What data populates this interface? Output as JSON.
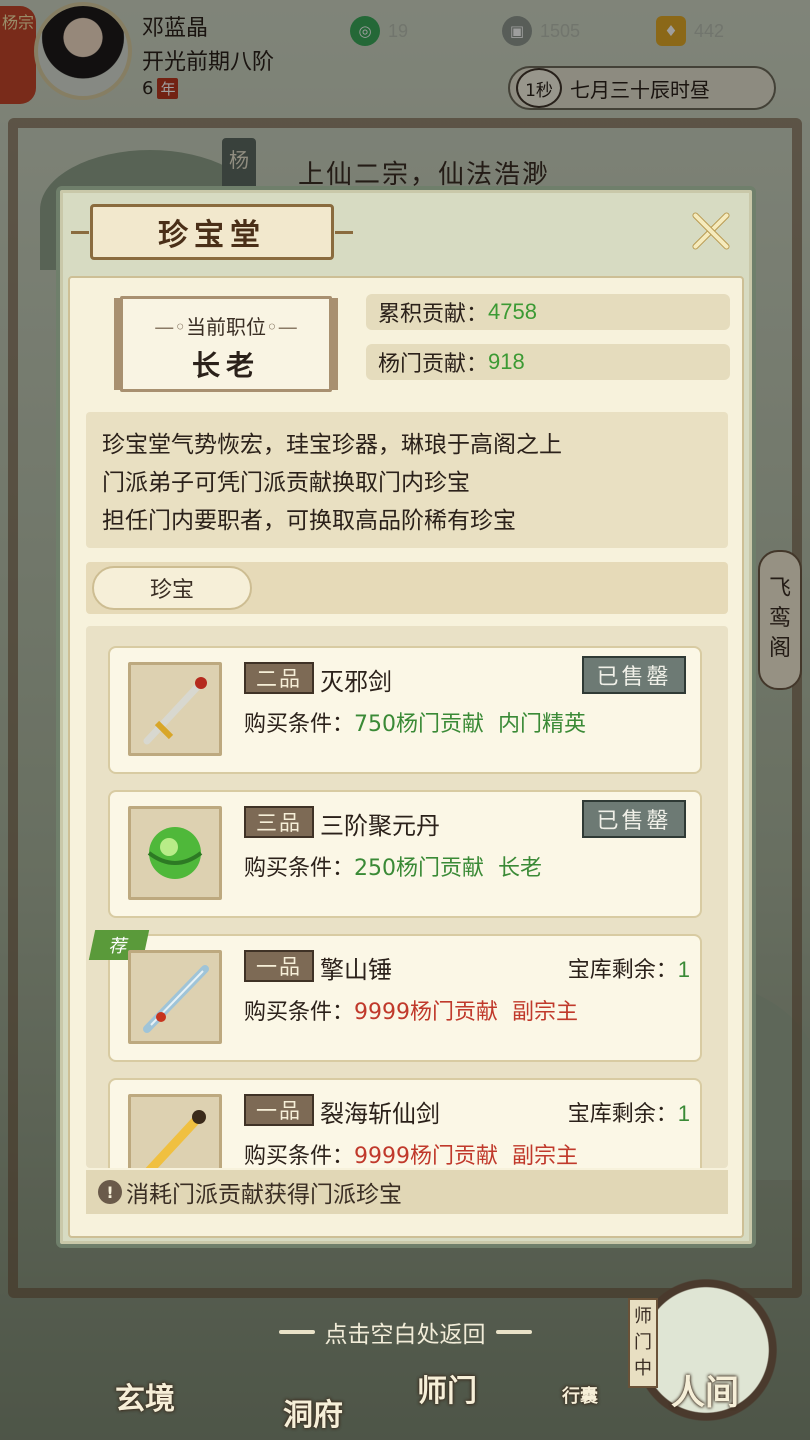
{
  "player": {
    "sect_short": "杨宗",
    "name": "邓蓝晶",
    "realm": "开光前期八阶",
    "age": "6",
    "age_unit": "年"
  },
  "resources": [
    {
      "icon": "jade-icon",
      "value": "19",
      "color": "#3aa85a"
    },
    {
      "icon": "coin-icon",
      "value": "1505",
      "color": "#9aa39a"
    },
    {
      "icon": "gold-ingot-icon",
      "value": "442",
      "color": "#e0a928"
    }
  ],
  "time": {
    "speed": "1秒",
    "date": "七月三十辰时昼"
  },
  "background": {
    "banner": "上仙二宗，仙法浩渺",
    "left_tag": "杨",
    "side_tag": "飞鸾阁"
  },
  "modal": {
    "title": "珍宝堂",
    "position_label": "当前职位",
    "position_value": "长老",
    "total_contrib_label": "累积贡献：",
    "total_contrib_value": "4758",
    "sect_contrib_label": "杨门贡献：",
    "sect_contrib_value": "918",
    "description": [
      "珍宝堂气势恢宏，珪宝珍器，琳琅于高阁之上",
      "门派弟子可凭门派贡献换取门内珍宝",
      "担任门内要职者，可换取高品阶稀有珍宝"
    ],
    "section_tab": "珍宝",
    "cond_label": "购买条件：",
    "items": [
      {
        "grade": "二品",
        "name": "灭邪剑",
        "cost": "750杨门贡献",
        "rank": "内门精英",
        "status": "已售罄",
        "stock_label": "",
        "stock": "",
        "recommended": false,
        "color": "#3a8a36"
      },
      {
        "grade": "三品",
        "name": "三阶聚元丹",
        "cost": "250杨门贡献",
        "rank": "长老",
        "status": "已售罄",
        "stock_label": "",
        "stock": "",
        "recommended": false,
        "color": "#3a8a36"
      },
      {
        "grade": "一品",
        "name": "擎山锤",
        "cost": "9999杨门贡献",
        "rank": "副宗主",
        "status": "",
        "stock_label": "宝库剩余：",
        "stock": "1",
        "recommended": true,
        "color": "#c0392b"
      },
      {
        "grade": "一品",
        "name": "裂海斩仙剑",
        "cost": "9999杨门贡献",
        "rank": "副宗主",
        "status": "",
        "stock_label": "宝库剩余：",
        "stock": "1",
        "recommended": false,
        "color": "#c0392b"
      }
    ],
    "recommend_tag": "荐",
    "footer_tip": "消耗门派贡献获得门派珍宝"
  },
  "tap_return": "点击空白处返回",
  "nav": {
    "items": [
      "玄境",
      "洞府",
      "师门",
      "行囊",
      "人间"
    ],
    "sect_vertical": "师门中"
  }
}
